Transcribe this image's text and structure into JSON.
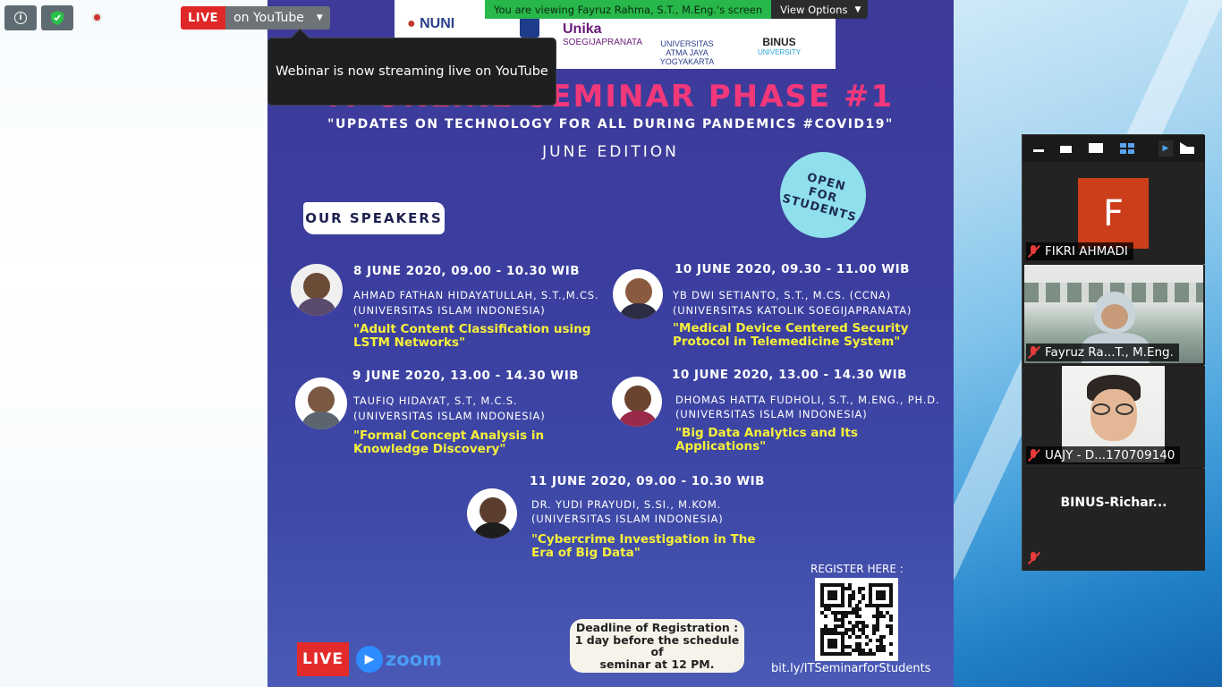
{
  "top_bar": {
    "info_icon": "info-icon",
    "shield_icon": "shield-icon",
    "live_label": "LIVE",
    "stream_target": "on YouTube",
    "dropdown_icon": "caret-down-icon"
  },
  "tooltip": {
    "text": "Webinar is now streaming live on YouTube"
  },
  "share_banner": {
    "viewing_text": "You are viewing Fayruz Rahma, S.T., M.Eng.'s screen",
    "view_options": "View Options"
  },
  "poster": {
    "logos": [
      "NUNI",
      "Unika",
      "SOEGIJAPRANATA",
      "UNIVERSITAS",
      "ATMA JAYA YOGYAKARTA",
      "BINUS",
      "UNIVERSITY"
    ],
    "title": "IT ONLINE SEMINAR PHASE #1",
    "subtitle": "\"UPDATES ON TECHNOLOGY FOR ALL DURING PANDEMICS #COVID19\"",
    "edition": "JUNE EDITION",
    "badge_lines": [
      "OPEN",
      "FOR",
      "STUDENTS"
    ],
    "speakers_heading": "OUR SPEAKERS",
    "speakers": [
      {
        "date": "8 JUNE 2020, 09.00 - 10.30 WIB",
        "name": "AHMAD FATHAN HIDAYATULLAH, S.T.,M.CS.",
        "uni": "(UNIVERSITAS ISLAM INDONESIA)",
        "topic": "\"Adult Content Classification using\nLSTM Networks\""
      },
      {
        "date": "10 JUNE 2020, 09.30 - 11.00 WIB",
        "name": "YB DWI SETIANTO, S.T., M.CS. (CCNA)",
        "uni": "(UNIVERSITAS KATOLIK SOEGIJAPRANATA)",
        "topic": "\"Medical Device Centered Security\nProtocol in Telemedicine System\""
      },
      {
        "date": "9 JUNE 2020, 13.00 - 14.30 WIB",
        "name": "TAUFIQ HIDAYAT, S.T, M.C.S.",
        "uni": "(UNIVERSITAS ISLAM INDONESIA)",
        "topic": "\"Formal Concept Analysis in\nKnowledge Discovery\""
      },
      {
        "date": "10 JUNE 2020, 13.00 - 14.30 WIB",
        "name": "DHOMAS HATTA FUDHOLI, S.T., M.ENG., PH.D.",
        "uni": "(UNIVERSITAS ISLAM INDONESIA)",
        "topic": "\"Big Data Analytics and Its\nApplications\""
      },
      {
        "date": "11 JUNE 2020, 09.00 - 10.30 WIB",
        "name": "DR. YUDI PRAYUDI, S.SI., M.KOM.",
        "uni": "(UNIVERSITAS ISLAM INDONESIA)",
        "topic": "\"Cybercrime Investigation in The\nEra of Big Data\""
      }
    ],
    "register_label": "REGISTER HERE :",
    "register_link": "bit.ly/ITSeminarforStudents",
    "deadline_lines": [
      "Deadline of Registration :",
      "1 day before the schedule of",
      "seminar at 12 PM."
    ],
    "live_badge": "LIVE",
    "zoom_text": "zoom"
  },
  "gallery": {
    "toolbar_icons": [
      "minimize-icon",
      "thumbnail-icon",
      "speaker-view-icon",
      "gallery-view-icon",
      "next-page-icon",
      "exit-fullscreen-icon"
    ],
    "participants": [
      {
        "initial": "F",
        "name": "FIKRI AHMADI",
        "muted": true
      },
      {
        "name": "Fayruz Ra...T., M.Eng.",
        "muted": true
      },
      {
        "name": "UAJY - D...170709140",
        "muted": true
      },
      {
        "name": "BINUS-Richar...",
        "muted": true
      }
    ]
  },
  "colors": {
    "poster_bg": "#3d3a9a",
    "title_pink": "#f2387a",
    "topic_yellow": "#f7f13a",
    "live_red": "#e02727",
    "share_green": "#27b74a"
  }
}
